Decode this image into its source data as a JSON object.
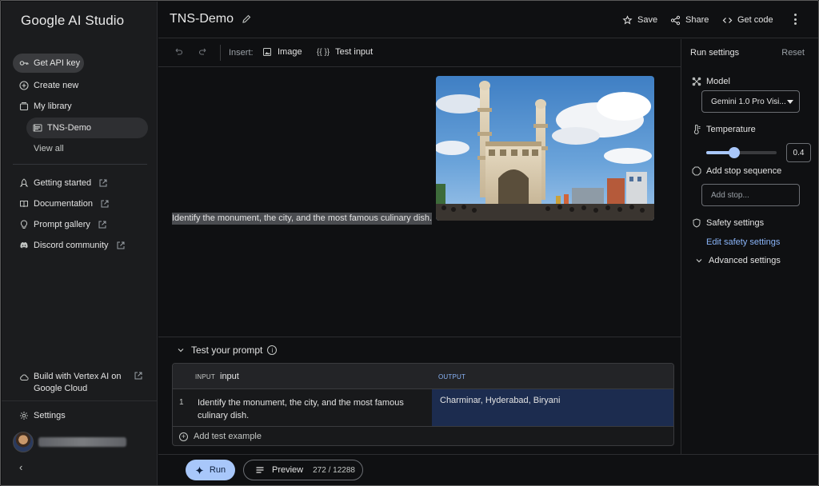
{
  "sidebar": {
    "brand": "Google AI Studio",
    "api_key": "Get API key",
    "create_new": "Create new",
    "my_library": "My library",
    "library_item": "TNS-Demo",
    "view_all": "View all",
    "links": [
      {
        "label": "Getting started",
        "icon": "rocket-icon"
      },
      {
        "label": "Documentation",
        "icon": "book-icon"
      },
      {
        "label": "Prompt gallery",
        "icon": "lightbulb-icon"
      },
      {
        "label": "Discord community",
        "icon": "discord-icon"
      }
    ],
    "vertex": "Build with Vertex AI on Google Cloud",
    "settings": "Settings"
  },
  "header": {
    "title": "TNS-Demo",
    "save": "Save",
    "share": "Share",
    "get_code": "Get code"
  },
  "toolbar": {
    "insert_label": "Insert:",
    "image": "Image",
    "test_input": "Test input",
    "test_input_icon": "{{ }}"
  },
  "prompt": {
    "text": "Identify the monument, the city, and the most famous culinary dish."
  },
  "test": {
    "title": "Test your prompt",
    "input_tag": "INPUT",
    "input_name": "input",
    "output_tag": "OUTPUT",
    "rows": [
      {
        "num": "1",
        "input": "Identify the monument, the city, and the most famous culinary dish.",
        "output": "Charminar, Hyderabad, Biryani"
      }
    ],
    "add_example": "Add test example"
  },
  "bottom": {
    "run": "Run",
    "preview": "Preview",
    "tokens": "272 / 12288"
  },
  "settings": {
    "title": "Run settings",
    "reset": "Reset",
    "model_label": "Model",
    "model_value": "Gemini 1.0 Pro Visi...",
    "temperature_label": "Temperature",
    "temperature_value": "0.4",
    "temperature_fraction": 0.4,
    "stop_label": "Add stop sequence",
    "stop_placeholder": "Add stop...",
    "safety_label": "Safety settings",
    "safety_link": "Edit safety settings",
    "advanced": "Advanced settings"
  },
  "colors": {
    "accent": "#a8c7fa",
    "link": "#8ab4f8",
    "output_bg": "#1c2c4f"
  }
}
